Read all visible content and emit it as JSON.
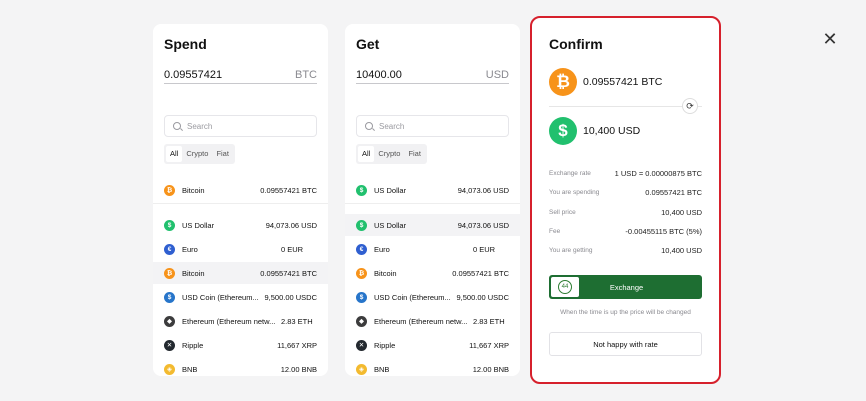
{
  "spend": {
    "title": "Spend",
    "amount": "0.09557421",
    "currency": "BTC",
    "search_placeholder": "Search",
    "filters": [
      "All",
      "Crypto",
      "Fiat"
    ],
    "selected": {
      "name": "Bitcoin",
      "balance": "0.09557421 BTC",
      "icon": "bitcoin-icon"
    },
    "items": [
      {
        "name": "US Dollar",
        "balance": "94,073.06 USD",
        "icon": "dollar-icon"
      },
      {
        "name": "Euro",
        "balance": "0 EUR",
        "icon": "euro-icon"
      },
      {
        "name": "Bitcoin",
        "balance": "0.09557421 BTC",
        "icon": "bitcoin-icon"
      },
      {
        "name": "USD Coin (Ethereum...",
        "balance": "9,500.00 USDC",
        "icon": "usdc-icon"
      },
      {
        "name": "Ethereum (Ethereum netw...",
        "balance": "2.83 ETH",
        "icon": "ethereum-icon"
      },
      {
        "name": "Ripple",
        "balance": "11,667 XRP",
        "icon": "ripple-icon"
      },
      {
        "name": "BNB",
        "balance": "12.00 BNB",
        "icon": "bnb-icon"
      }
    ]
  },
  "get": {
    "title": "Get",
    "amount": "10400.00",
    "currency": "USD",
    "search_placeholder": "Search",
    "filters": [
      "All",
      "Crypto",
      "Fiat"
    ],
    "selected": {
      "name": "US Dollar",
      "balance": "94,073.06 USD",
      "icon": "dollar-icon"
    },
    "items": [
      {
        "name": "US Dollar",
        "balance": "94,073.06 USD",
        "icon": "dollar-icon"
      },
      {
        "name": "Euro",
        "balance": "0 EUR",
        "icon": "euro-icon"
      },
      {
        "name": "Bitcoin",
        "balance": "0.09557421 BTC",
        "icon": "bitcoin-icon"
      },
      {
        "name": "USD Coin (Ethereum...",
        "balance": "9,500.00 USDC",
        "icon": "usdc-icon"
      },
      {
        "name": "Ethereum (Ethereum netw...",
        "balance": "2.83 ETH",
        "icon": "ethereum-icon"
      },
      {
        "name": "Ripple",
        "balance": "11,667 XRP",
        "icon": "ripple-icon"
      },
      {
        "name": "BNB",
        "balance": "12.00 BNB",
        "icon": "bnb-icon"
      }
    ]
  },
  "confirm": {
    "title": "Confirm",
    "from_amount": "0.09557421 BTC",
    "to_amount": "10,400 USD",
    "details": [
      {
        "label": "Exchange rate",
        "value": "1 USD = 0.00000875 BTC"
      },
      {
        "label": "You are spending",
        "value": "0.09557421 BTC"
      },
      {
        "label": "Sell price",
        "value": "10,400 USD"
      },
      {
        "label": "Fee",
        "value": "-0.00455115 BTC (5%)"
      },
      {
        "label": "You are getting",
        "value": "10,400 USD"
      }
    ],
    "timer": "44",
    "exchange_label": "Exchange",
    "time_note": "When the time is up the price will be changed",
    "unhappy_label": "Not happy with rate"
  },
  "colors": {
    "bitcoin": "#f7931a",
    "dollar": "#21c06e",
    "euro": "#2f5fd0",
    "usdc": "#2775ca",
    "ethereum": "#3c3c3d",
    "ripple": "#23292f",
    "bnb": "#f3ba2f",
    "exchange_button": "#1e6e32",
    "highlight_border": "#d6202c"
  }
}
